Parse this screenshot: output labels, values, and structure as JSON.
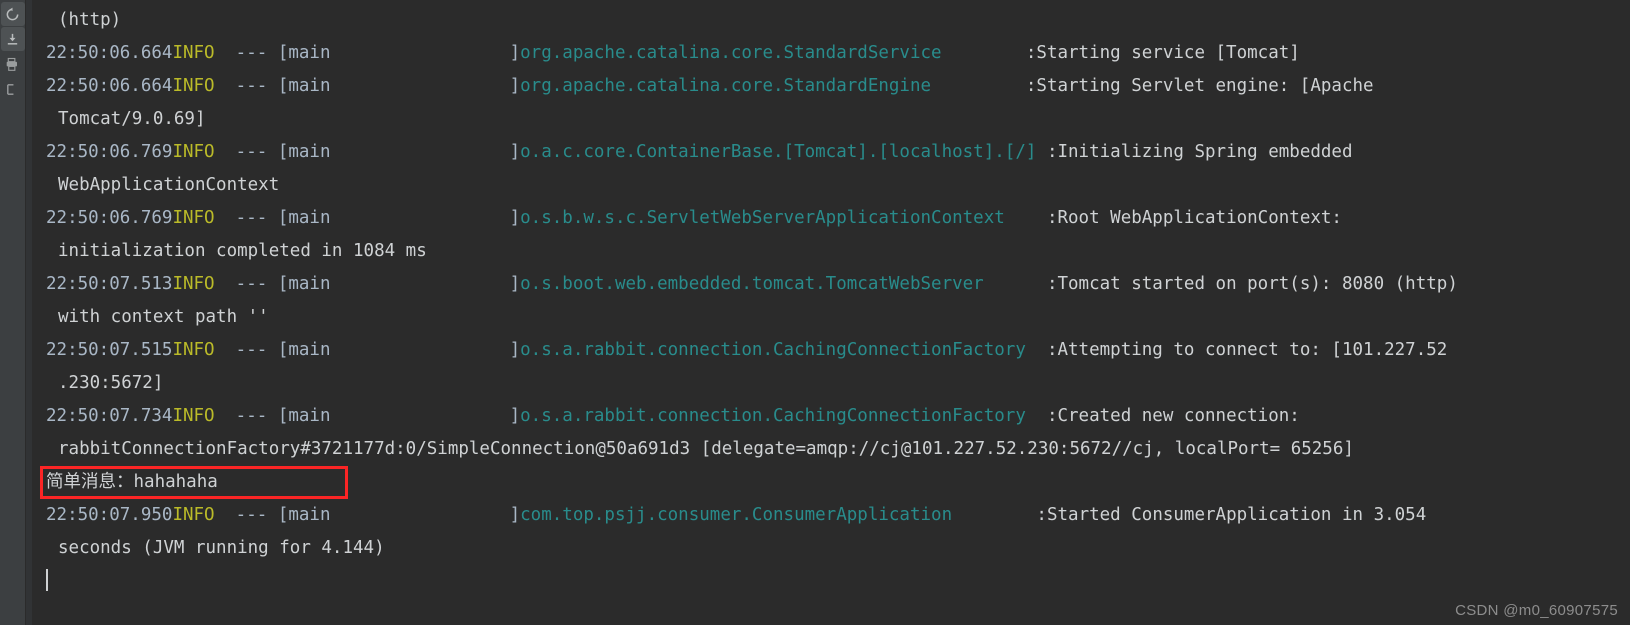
{
  "toolbar": {
    "buttons": [
      {
        "name": "rerun-icon",
        "title": "Rerun"
      },
      {
        "name": "scroll-to-end-icon",
        "title": "Scroll to End"
      },
      {
        "name": "print-icon",
        "title": "Print"
      },
      {
        "name": "soft-wrap-icon",
        "title": "Soft-Wrap"
      }
    ]
  },
  "console": {
    "lines": [
      {
        "type": "wrap",
        "text": "(http)"
      },
      {
        "type": "log",
        "time": "22:50:06.664",
        "level": "INFO",
        "dash": "  --- ",
        "thread": "[main                 ]",
        "logger": "org.apache.catalina.core.StandardService",
        "logger_pad": "        ",
        "message": ":Starting service [Tomcat]"
      },
      {
        "type": "log",
        "time": "22:50:06.664",
        "level": "INFO",
        "dash": "  --- ",
        "thread": "[main                 ]",
        "logger": "org.apache.catalina.core.StandardEngine",
        "logger_pad": "         ",
        "message": ":Starting Servlet engine: [Apache"
      },
      {
        "type": "wrap",
        "text": "Tomcat/9.0.69]"
      },
      {
        "type": "log",
        "time": "22:50:06.769",
        "level": "INFO",
        "dash": "  --- ",
        "thread": "[main                 ]",
        "logger": "o.a.c.core.ContainerBase.[Tomcat].[localhost].[/]",
        "logger_pad": " ",
        "message": ":Initializing Spring embedded"
      },
      {
        "type": "wrap",
        "text": "WebApplicationContext"
      },
      {
        "type": "log",
        "time": "22:50:06.769",
        "level": "INFO",
        "dash": "  --- ",
        "thread": "[main                 ]",
        "logger": "o.s.b.w.s.c.ServletWebServerApplicationContext",
        "logger_pad": "    ",
        "message": ":Root WebApplicationContext:"
      },
      {
        "type": "wrap",
        "text": "initialization completed in 1084 ms"
      },
      {
        "type": "log",
        "time": "22:50:07.513",
        "level": "INFO",
        "dash": "  --- ",
        "thread": "[main                 ]",
        "logger": "o.s.boot.web.embedded.tomcat.TomcatWebServer",
        "logger_pad": "      ",
        "message": ":Tomcat started on port(s): 8080 (http)"
      },
      {
        "type": "wrap",
        "text": "with context path ''"
      },
      {
        "type": "log",
        "time": "22:50:07.515",
        "level": "INFO",
        "dash": "  --- ",
        "thread": "[main                 ]",
        "logger": "o.s.a.rabbit.connection.CachingConnectionFactory",
        "logger_pad": "  ",
        "message": ":Attempting to connect to: [101.227.52"
      },
      {
        "type": "wrap",
        "text": ".230:5672]"
      },
      {
        "type": "log",
        "time": "22:50:07.734",
        "level": "INFO",
        "dash": "  --- ",
        "thread": "[main                 ]",
        "logger": "o.s.a.rabbit.connection.CachingConnectionFactory",
        "logger_pad": "  ",
        "message": ":Created new connection:"
      },
      {
        "type": "wrap",
        "text": "rabbitConnectionFactory#3721177d:0/SimpleConnection@50a691d3 [delegate=amqp://cj@101.227.52.230:5672//cj, localPort= 65256]"
      },
      {
        "type": "highlight",
        "label": "简单消息：",
        "value": "hahahaha"
      },
      {
        "type": "log",
        "time": "22:50:07.950",
        "level": "INFO",
        "dash": "  --- ",
        "thread": "[main                 ]",
        "logger": "com.top.psjj.consumer.ConsumerApplication",
        "logger_pad": "        ",
        "message": ":Started ConsumerApplication in 3.054"
      },
      {
        "type": "wrap",
        "text": "seconds (JVM running for 4.144)"
      },
      {
        "type": "caret"
      }
    ]
  },
  "watermark": {
    "text": "CSDN @m0_60907575"
  },
  "colors": {
    "background": "#2b2b2b",
    "toolstrip": "#3c3f41",
    "text": "#cfd2d4",
    "timestamp": "#a9b7c6",
    "level_info": "#bbbb29",
    "logger": "#298c8c",
    "highlight_border": "#fb2525"
  }
}
